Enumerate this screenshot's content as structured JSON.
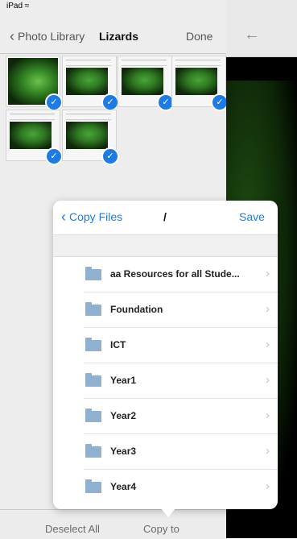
{
  "status_bar": {
    "device": "iPad",
    "wifi_icon": "wifi-icon"
  },
  "nav": {
    "back_label": "Photo Library",
    "title": "Lizards",
    "done_label": "Done"
  },
  "right_panel": {
    "back_icon": "arrow-left-icon"
  },
  "thumbnails": [
    {
      "selected": true
    },
    {
      "selected": true
    },
    {
      "selected": true
    },
    {
      "selected": true
    },
    {
      "selected": true
    },
    {
      "selected": true
    }
  ],
  "popover": {
    "back_label": "Copy Files",
    "path": "/",
    "save_label": "Save",
    "folders": [
      {
        "label": "aa Resources for all Stude..."
      },
      {
        "label": "Foundation"
      },
      {
        "label": "ICT"
      },
      {
        "label": "Year1"
      },
      {
        "label": "Year2"
      },
      {
        "label": "Year3"
      },
      {
        "label": "Year4"
      }
    ]
  },
  "bottom_bar": {
    "deselect_label": "Deselect All",
    "copy_label": "Copy to"
  },
  "colors": {
    "accent": "#1e7be6",
    "folder": "#8fb0cf"
  }
}
